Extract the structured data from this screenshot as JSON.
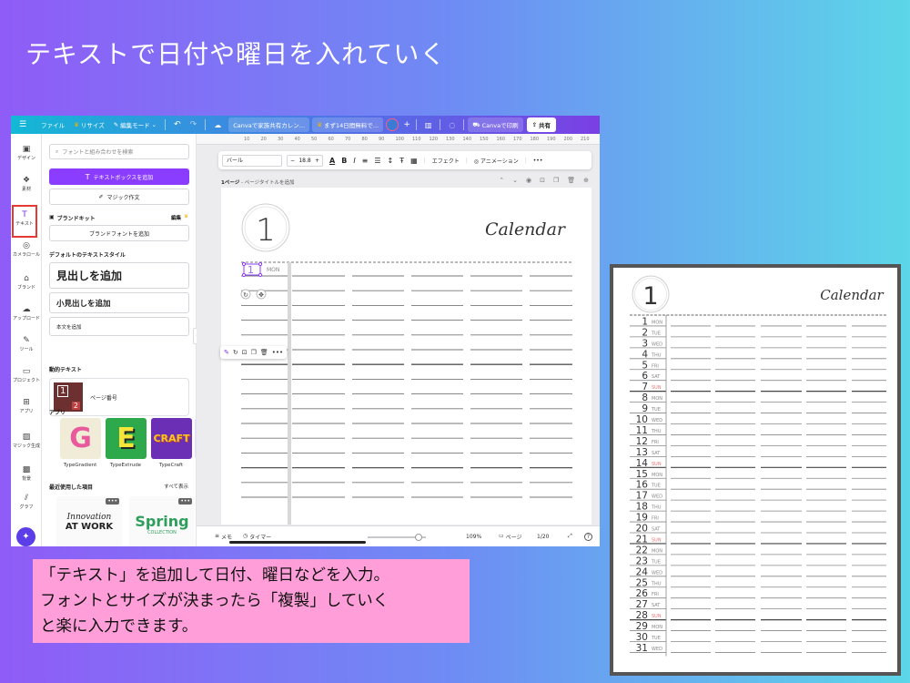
{
  "slide": {
    "title": "テキストで日付や曜日を入れていく",
    "caption_lines": [
      "「テキスト」を追加して日付、曜日などを入力。",
      "フォントとサイズが決まったら「複製」していく",
      "と楽に入力できます。"
    ],
    "caption_bg": "#ff9ed8"
  },
  "topbar": {
    "menu_icon": "hamburger-icon",
    "file": "ファイル",
    "resize": "リサイズ",
    "edit_mode": "編集モード",
    "doc_title": "Canvaで家族共有カレン…",
    "promo": "まず14日間無料で…",
    "print": "Canvaで印刷",
    "share": "共有",
    "crown_color": "#f5b400"
  },
  "rail": {
    "items": [
      {
        "label": "デザイン",
        "icon": "▣"
      },
      {
        "label": "素材",
        "icon": "❖"
      },
      {
        "label": "テキスト",
        "icon": "T"
      },
      {
        "label": "カメラロール",
        "icon": "◎"
      },
      {
        "label": "ブランド",
        "icon": "⌂"
      },
      {
        "label": "アップロード",
        "icon": "☁"
      },
      {
        "label": "ツール",
        "icon": "✎"
      },
      {
        "label": "プロジェクト",
        "icon": "▭"
      },
      {
        "label": "アプリ",
        "icon": "⊞"
      },
      {
        "label": "マジック生成",
        "icon": "▨"
      },
      {
        "label": "背景",
        "icon": "▩"
      },
      {
        "label": "グラフ",
        "icon": "⫽"
      }
    ]
  },
  "panel": {
    "search_placeholder": "フォントと組み合わせを検索",
    "add_textbox": "テキストボックスを追加",
    "magic_write": "マジック作文",
    "brand_kit": "ブランドキット",
    "edit": "編集",
    "add_brand_font": "ブランドフォントを追加",
    "default_styles": "デフォルトのテキストスタイル",
    "heading": "見出しを追加",
    "subheading": "小見出しを追加",
    "body": "本文を追加",
    "dynamic_text": "動的テキスト",
    "page_number": "ページ番号",
    "apps": "アプリ",
    "app_items": [
      {
        "label": "TypeGradient",
        "glyph": "G"
      },
      {
        "label": "TypeExtrude",
        "glyph": "E"
      },
      {
        "label": "TypeCraft",
        "glyph": "CRAFT"
      }
    ],
    "recent": "最近使用した項目",
    "see_all": "すべて表示",
    "recent_items": [
      {
        "line1": "Innovation",
        "line2": "AT WORK"
      },
      {
        "line1": "Spring",
        "line2": "COLLECTION"
      }
    ]
  },
  "editor": {
    "ruler_ticks": [
      "10",
      "20",
      "30",
      "40",
      "50",
      "60",
      "70",
      "80",
      "90",
      "100",
      "110",
      "120",
      "130",
      "140",
      "150",
      "160",
      "170",
      "180",
      "190",
      "200",
      "210"
    ],
    "font": "バール",
    "font_size": "18.8",
    "effects": "エフェクト",
    "animation": "アニメーション",
    "page_label": "1ページ",
    "page_title_placeholder": "ページタイトルを追加",
    "notes": "メモ",
    "timer": "タイマー",
    "zoom": "109%",
    "zoom_fraction": 0.88,
    "pages": "ページ",
    "page_count": "1/20"
  },
  "calendar": {
    "month": "1",
    "title": "Calendar",
    "first_day": "1",
    "first_weekday": "MON",
    "weekday_red": "#e57373",
    "days": [
      {
        "d": "1",
        "w": "MON"
      },
      {
        "d": "2",
        "w": "TUE"
      },
      {
        "d": "3",
        "w": "WED"
      },
      {
        "d": "4",
        "w": "THU"
      },
      {
        "d": "5",
        "w": "FRI"
      },
      {
        "d": "6",
        "w": "SAT"
      },
      {
        "d": "7",
        "w": "SUN"
      },
      {
        "d": "8",
        "w": "MON"
      },
      {
        "d": "9",
        "w": "TUE"
      },
      {
        "d": "10",
        "w": "WED"
      },
      {
        "d": "11",
        "w": "THU"
      },
      {
        "d": "12",
        "w": "FRI"
      },
      {
        "d": "13",
        "w": "SAT"
      },
      {
        "d": "14",
        "w": "SUN"
      },
      {
        "d": "15",
        "w": "MON"
      },
      {
        "d": "16",
        "w": "TUE"
      },
      {
        "d": "17",
        "w": "WED"
      },
      {
        "d": "18",
        "w": "THU"
      },
      {
        "d": "19",
        "w": "FRI"
      },
      {
        "d": "20",
        "w": "SAT"
      },
      {
        "d": "21",
        "w": "SUN"
      },
      {
        "d": "22",
        "w": "MON"
      },
      {
        "d": "23",
        "w": "TUE"
      },
      {
        "d": "24",
        "w": "WED"
      },
      {
        "d": "25",
        "w": "THU"
      },
      {
        "d": "26",
        "w": "FRI"
      },
      {
        "d": "27",
        "w": "SAT"
      },
      {
        "d": "28",
        "w": "SUN"
      },
      {
        "d": "29",
        "w": "MON"
      },
      {
        "d": "30",
        "w": "TUE"
      },
      {
        "d": "31",
        "w": "WED"
      }
    ]
  }
}
